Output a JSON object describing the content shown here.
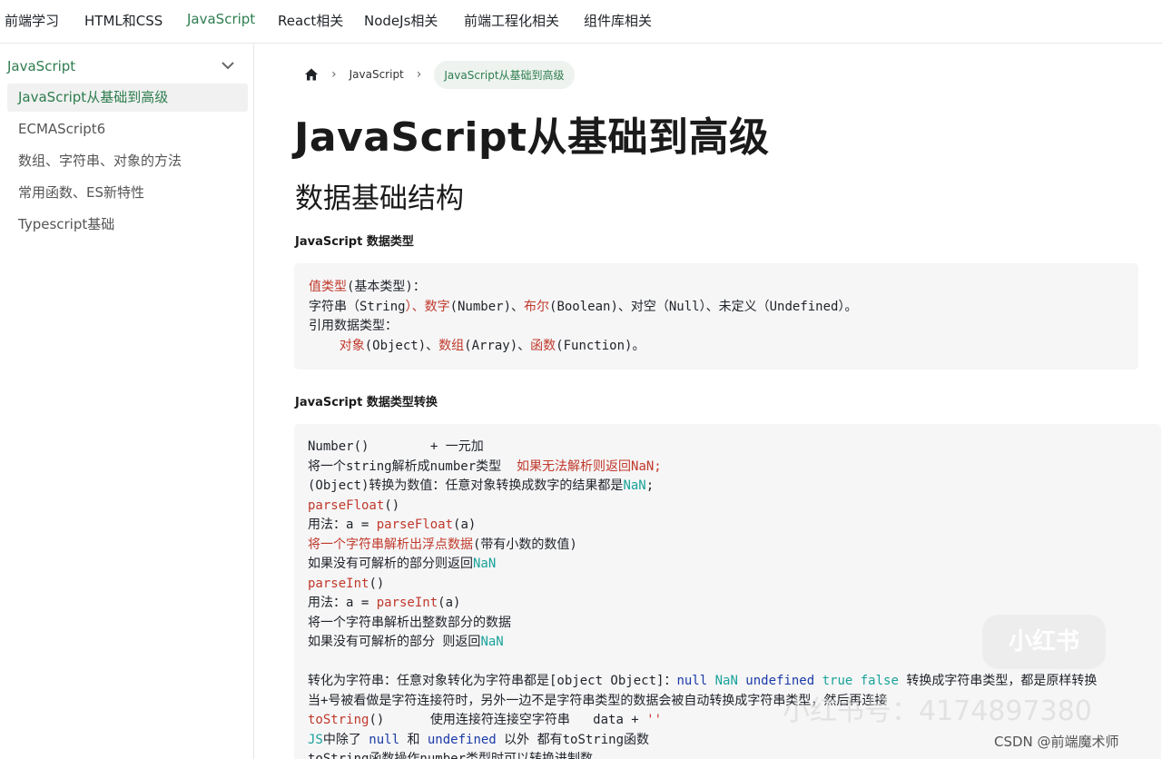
{
  "nav": {
    "brand": "前端学习",
    "items": [
      {
        "label": "HTML和CSS",
        "active": false
      },
      {
        "label": "JavaScript",
        "active": true
      },
      {
        "label": "React相关",
        "active": false
      },
      {
        "label": "NodeJs相关",
        "active": false
      },
      {
        "label": "前端工程化相关",
        "active": false
      },
      {
        "label": "组件库相关",
        "active": false
      }
    ]
  },
  "sidebar": {
    "heading": "JavaScript",
    "items": [
      {
        "label": "JavaScript从基础到高级",
        "active": true
      },
      {
        "label": "ECMAScript6",
        "active": false
      },
      {
        "label": "数组、字符串、对象的方法",
        "active": false
      },
      {
        "label": "常用函数、ES新特性",
        "active": false
      },
      {
        "label": "Typescript基础",
        "active": false
      }
    ]
  },
  "breadcrumb": {
    "home_icon": "home-icon",
    "items": [
      "JavaScript",
      "JavaScript从基础到高级"
    ]
  },
  "content": {
    "title": "JavaScript从基础到高级",
    "section": "数据基础结构",
    "sub1": "JavaScript 数据类型",
    "sub2": "JavaScript 数据类型转换",
    "code1": [
      {
        "a": "值类型",
        "b": "(基本类型)："
      },
      {
        "a": "字符串（String",
        "b": "）、数字",
        "c": "(Number)、",
        "d": "布尔",
        "e": "(Boolean)、对空（Null）、未定义（Undefined）。"
      },
      {
        "a": "引用数据类型："
      },
      {
        "a": "    对象",
        "b": "(Object)、",
        "c": "数组",
        "d": "(Array)、",
        "e": "函数",
        "f": "(Function)。"
      }
    ],
    "code2": {
      "l1": "Number()        + 一元加",
      "l2a": "将一个string解析成number类型  ",
      "l2b": "如果无法解析则返回NaN;",
      "l3a": "(Object)转换为数值：任意对象转换成数字的结果都是",
      "l3b": "NaN",
      "l3c": ";",
      "l4": "parseFloat",
      "l4b": "()",
      "l5a": "用法：a = ",
      "l5b": "parseFloat",
      "l5c": "(a)",
      "l6a": "将一个字符串解析出浮点数据",
      "l6b": "(带有小数的数值)",
      "l7a": "如果没有可解析的部分则返回",
      "l7b": "NaN",
      "l8": "parseInt",
      "l8b": "()",
      "l9a": "用法：a = ",
      "l9b": "parseInt",
      "l9c": "(a)",
      "l10": "将一个字符串解析出整数部分的数据",
      "l11a": "如果没有可解析的部分 则返回",
      "l11b": "NaN",
      "l12a": "转化为字符串：任意对象转化为字符串都是[object Object]：",
      "l12b": "null",
      "l12c": " NaN",
      "l12d": " undefined",
      "l12e": " true",
      "l12f": " false",
      "l12g": " 转换成字符串类型，都是原样转换",
      "l13": "当+号被看做是字符连接符时，另外一边不是字符串类型的数据会被自动转换成字符串类型，然后再连接",
      "l14a": "toString",
      "l14b": "()      使用连接符连接空字符串   data + ",
      "l14c": "''",
      "l15a": "JS",
      "l15b": "中除了 ",
      "l15c": "null",
      "l15d": " 和 ",
      "l15e": "undefined",
      "l15f": " 以外 都有toString函数",
      "l16": "toString函数操作number类型时可以转换进制数"
    }
  },
  "watermarks": {
    "logo": "小红书",
    "id_text": "小红书号：4174897380",
    "csdn": "CSDN @前端魔术师"
  }
}
